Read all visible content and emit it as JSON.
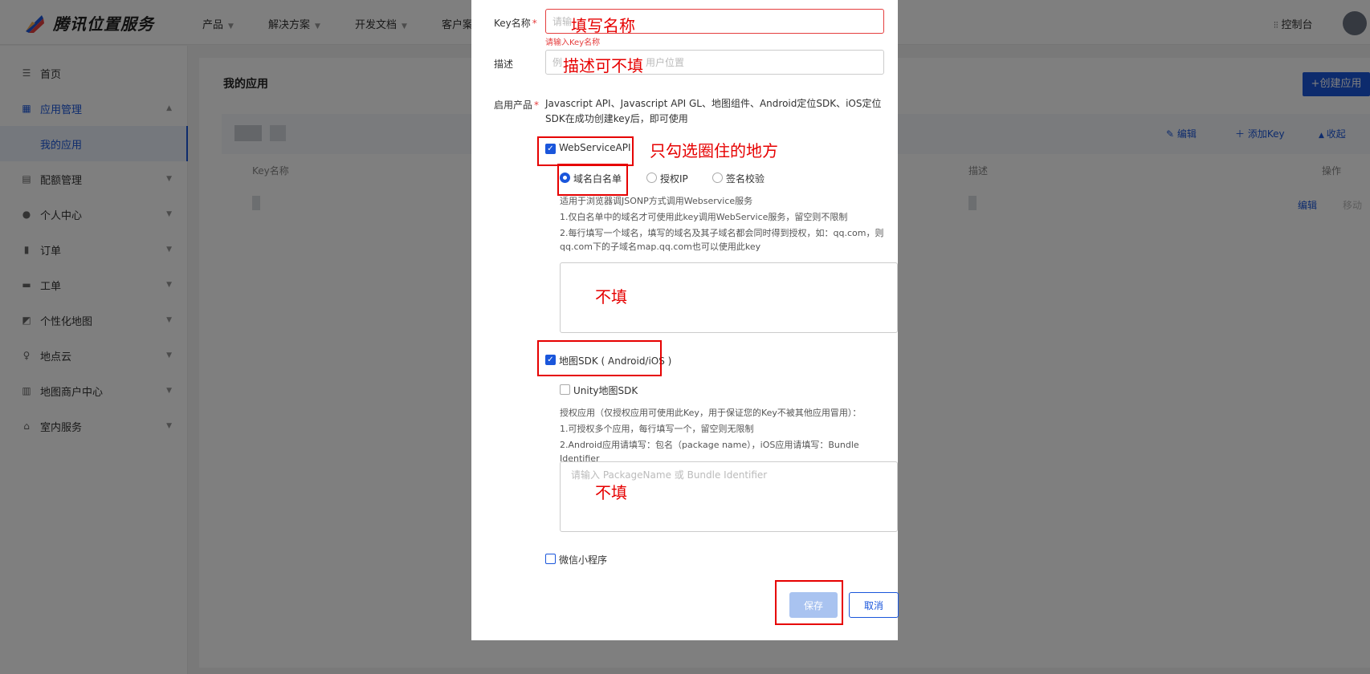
{
  "header": {
    "logo_text": "腾讯位置服务",
    "nav": [
      {
        "label": "产品"
      },
      {
        "label": "解决方案"
      },
      {
        "label": "开发文档"
      },
      {
        "label": "客户案"
      }
    ],
    "console_label": "控制台"
  },
  "sidebar": {
    "items": [
      {
        "label": "首页",
        "icon": "home-icon"
      },
      {
        "label": "应用管理",
        "icon": "grid-icon"
      },
      {
        "label": "我的应用"
      },
      {
        "label": "配额管理",
        "icon": "chart-icon"
      },
      {
        "label": "个人中心",
        "icon": "user-icon"
      },
      {
        "label": "订单",
        "icon": "clipboard-icon"
      },
      {
        "label": "工单",
        "icon": "ticket-icon"
      },
      {
        "label": "个性化地图",
        "icon": "map-style-icon"
      },
      {
        "label": "地点云",
        "icon": "pin-icon"
      },
      {
        "label": "地图商户中心",
        "icon": "shop-icon"
      },
      {
        "label": "室内服务",
        "icon": "indoor-icon"
      }
    ]
  },
  "main": {
    "title": "我的应用",
    "create_button": "+创建应用",
    "actions": {
      "edit": "编辑",
      "add_key": "添加Key",
      "collapse": "收起"
    },
    "columns": {
      "key_name": "Key名称",
      "desc": "描述",
      "ops": "操作"
    },
    "row": {
      "edit": "编辑",
      "move": "移动"
    }
  },
  "modal": {
    "key_name_label": "Key名称",
    "key_name_placeholder": "请输",
    "key_name_error": "请输入Key名称",
    "desc_label": "描述",
    "desc_placeholder_start": "例",
    "desc_placeholder_end": "用户位置",
    "products_label": "启用产品",
    "products_text": "Javascript API、Javascript API GL、地图组件、Android定位SDK、iOS定位SDK在成功创建key后，即可使用",
    "ws_label": "WebServiceAPI",
    "ws_options": [
      "域名白名单",
      "授权IP",
      "签名校验"
    ],
    "ws_notes": [
      "适用于浏览器调JSONP方式调用Webservice服务",
      "1.仅白名单中的域名才可使用此key调用WebService服务，留空则不限制",
      "2.每行填写一个域名，填写的域名及其子域名都会同时得到授权，如：qq.com，则qq.com下的子域名map.qq.com也可以使用此key"
    ],
    "sdk_label": "地图SDK ( Android/iOS )",
    "unity_label": "Unity地图SDK",
    "sdk_notes": [
      "授权应用（仅授权应用可使用此Key，用于保证您的Key不被其他应用冒用）：",
      "1.可授权多个应用，每行填写一个，留空则无限制",
      "2.Android应用请填写：包名（package name），iOS应用请填写：Bundle Identifier"
    ],
    "sdk_placeholder": "请输入 PackageName 或 Bundle Identifier",
    "wechat_label": "微信小程序",
    "save": "保存",
    "cancel": "取消"
  },
  "annotations": {
    "fill_name": "填写名称",
    "desc_optional": "描述可不填",
    "only_check": "只勾选圈住的地方",
    "leave_empty_1": "不填",
    "leave_empty_2": "不填"
  }
}
